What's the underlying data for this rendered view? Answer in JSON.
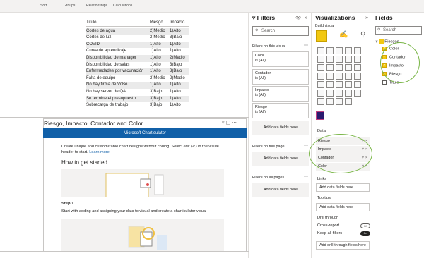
{
  "ribbon": {
    "tabs": [
      "Sort",
      "Groups",
      "Relationships",
      "Calculations"
    ]
  },
  "table": {
    "headers": [
      "Titulo",
      "Riesgo",
      "Impacto"
    ],
    "rows": [
      [
        "Cortes de agua",
        "2)Medio",
        "1)Alto"
      ],
      [
        "Cortes de luz",
        "2)Medio",
        "3)Bajo"
      ],
      [
        "COVID",
        "1)Alto",
        "1)Alto"
      ],
      [
        "Curva de aprendizaje",
        "1)Alto",
        "1)Alto"
      ],
      [
        "Disponibilidad de manager",
        "1)Alto",
        "2)Medio"
      ],
      [
        "Disponibilidad de salas",
        "1)Alto",
        "3)Bajo"
      ],
      [
        "Enfermedades por vacunación",
        "1)Alto",
        "3)Bajo"
      ],
      [
        "Falta de equipo",
        "2)Medio",
        "2)Medio"
      ],
      [
        "No hay firma de VoBo",
        "1)Alto",
        "1)Alto"
      ],
      [
        "No hay server de QA",
        "3)Bajo",
        "1)Alto"
      ],
      [
        "Se termine el presupuesto",
        "3)Bajo",
        "1)Alto"
      ],
      [
        "Sobrecarga de trabajo",
        "3)Bajo",
        "1)Alto"
      ]
    ]
  },
  "card": {
    "title": "Riesgo, Impacto, Contador and Color",
    "banner": "Microsoft Charticulator",
    "description": "Create unique and customizable chart designs without coding. Select edit (✐) in the visual header to start.",
    "learn_more": "Learn more",
    "how_to": "How to get started",
    "step1_label": "Step 1",
    "step1_text": "Start with adding and assigning your data to visual and create a charticulator visual"
  },
  "filters": {
    "title": "Filters",
    "search_placeholder": "Search",
    "on_visual": "Filters on this visual",
    "cards": [
      {
        "name": "Color",
        "value": "is (All)"
      },
      {
        "name": "Contador",
        "value": "is (All)"
      },
      {
        "name": "Impacto",
        "value": "is (All)"
      },
      {
        "name": "Riesgo",
        "value": "is (All)"
      }
    ],
    "add_label": "Add data fields here",
    "on_page": "Filters on this page",
    "on_all": "Filters on all pages"
  },
  "viz": {
    "title": "Visualizations",
    "build": "Build visual",
    "data_label": "Data",
    "data_fields": [
      "Riesgo",
      "Impacto",
      "Contador",
      "Color"
    ],
    "links": "Links",
    "tooltips": "Tooltips",
    "drill": "Drill through",
    "cross": "Cross-report",
    "cross_state": "Off",
    "keep": "Keep all filters",
    "keep_state": "On",
    "add_label": "Add data fields here",
    "add_drill": "Add drill-through fields here"
  },
  "fields": {
    "title": "Fields",
    "search_placeholder": "Search",
    "table_name": "Riesgos",
    "items": [
      {
        "name": "Color",
        "checked": true
      },
      {
        "name": "Contador",
        "checked": true
      },
      {
        "name": "Impacto",
        "checked": true
      },
      {
        "name": "Riesgo",
        "checked": true
      },
      {
        "name": "Titulo",
        "checked": false
      }
    ]
  }
}
